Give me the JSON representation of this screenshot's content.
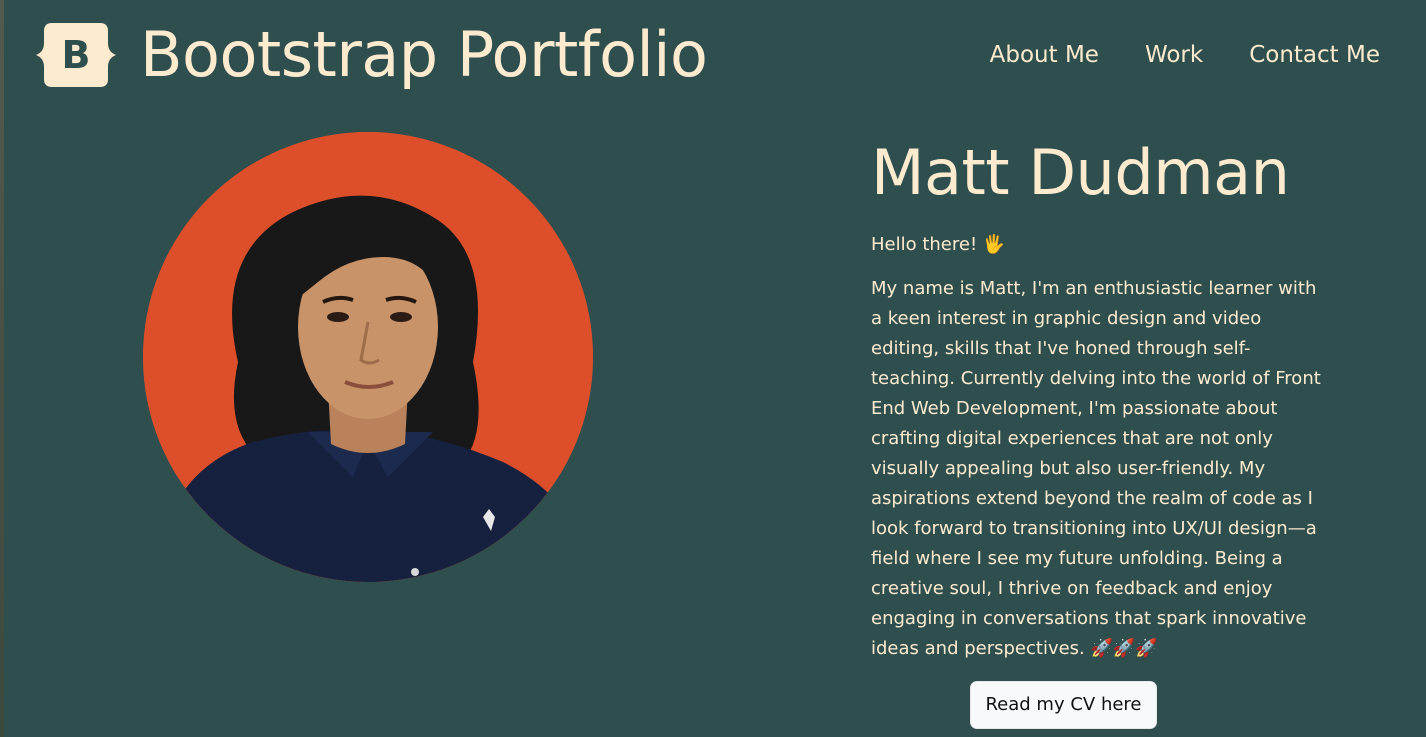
{
  "brand": {
    "logo_letter": "B",
    "title": "Bootstrap Portfolio"
  },
  "nav": {
    "items": [
      {
        "label": "About Me"
      },
      {
        "label": "Work"
      },
      {
        "label": "Contact Me"
      }
    ]
  },
  "profile": {
    "photo_icon": "profile-photo",
    "name": "Matt Dudman",
    "greeting": "Hello there! 🖐",
    "bio": "My name is Matt, I'm an enthusiastic learner with a keen interest in graphic design and video editing, skills that I've honed through self-teaching. Currently delving into the world of Front End Web Development, I'm passionate about crafting digital experiences that are not only visually appealing but also user-friendly. My aspirations extend beyond the realm of code as I look forward to transitioning into UX/UI design—a field where I see my future unfolding. Being a creative soul, I thrive on feedback and enjoy engaging in conversations that spark innovative ideas and perspectives. 🚀🚀🚀",
    "cv_button": "Read my CV here"
  },
  "colors": {
    "background": "#2f4f4f",
    "text": "#fdebd0",
    "photo_background": "#dc4f2a",
    "button_background": "#f8f9fa"
  }
}
